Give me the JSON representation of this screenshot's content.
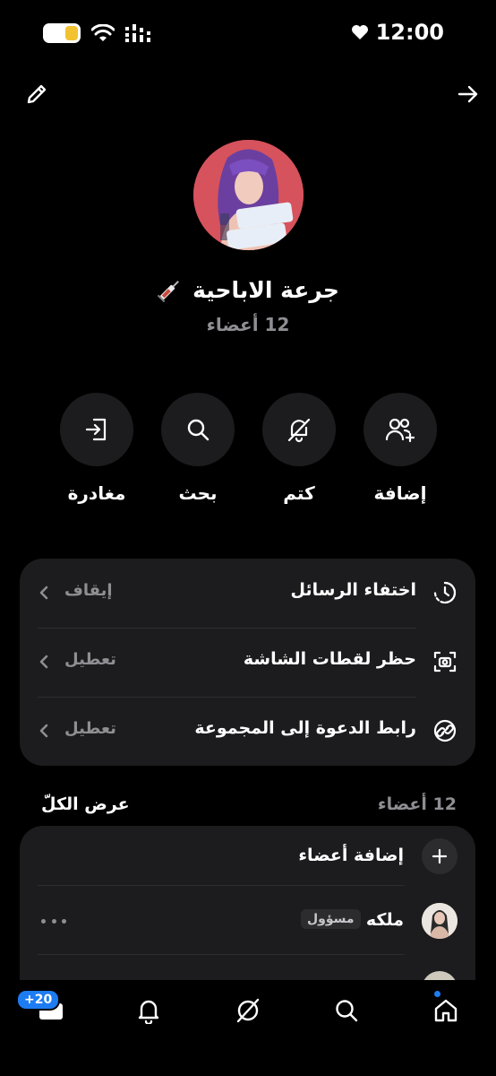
{
  "status_bar": {
    "time": "12:00"
  },
  "group": {
    "name": "جرعة الاباحية",
    "members_count": "12 أعضاء",
    "avatar_caption": "جرعة إباحية"
  },
  "actions": [
    {
      "label": "إضافة",
      "icon": "add-user-icon"
    },
    {
      "label": "كتم",
      "icon": "bell-off-icon"
    },
    {
      "label": "بحث",
      "icon": "search-icon"
    },
    {
      "label": "مغادرة",
      "icon": "leave-icon"
    }
  ],
  "settings": [
    {
      "label": "اختفاء الرسائل",
      "value": "إيقاف",
      "icon": "timer-icon"
    },
    {
      "label": "حظر لقطات الشاشة",
      "value": "تعطيل",
      "icon": "screenshot-icon"
    },
    {
      "label": "رابط الدعوة إلى المجموعة",
      "value": "تعطيل",
      "icon": "link-icon"
    }
  ],
  "members_section": {
    "count": "12 أعضاء",
    "view_all": "عرض الكلّ",
    "add_members": "إضافة أعضاء",
    "members": [
      {
        "name": "ملكه",
        "role": "مسؤول"
      }
    ]
  },
  "bottom_nav": {
    "badge": "+20",
    "items": [
      "messages-icon",
      "bell-icon",
      "compass-icon",
      "search-icon",
      "home-icon"
    ]
  },
  "colors": {
    "background": "#000000",
    "card": "#1c1c1e",
    "muted": "#8e8e93",
    "accent": "#1d7cf2"
  }
}
